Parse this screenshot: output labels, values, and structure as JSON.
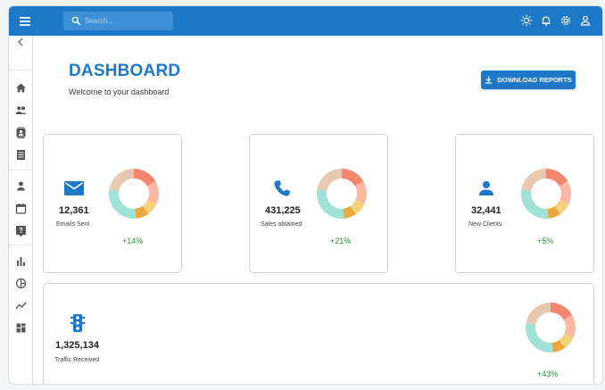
{
  "search": {
    "placeholder": "Search..."
  },
  "header": {
    "title": "DASHBOARD",
    "subtitle": "Welcome to your dashboard"
  },
  "download_button": {
    "label": "DOWNLOAD REPORTS"
  },
  "stats": [
    {
      "value": "12,361",
      "label": "Emails Sent",
      "change": "+14%",
      "icon": "email-icon"
    },
    {
      "value": "431,225",
      "label": "Sales obtained",
      "change": "+21%",
      "icon": "phone-icon"
    },
    {
      "value": "32,441",
      "label": "New Clients",
      "change": "+5%",
      "icon": "person-add-icon"
    },
    {
      "value": "1,325,134",
      "label": "Traffic Received",
      "change": "+43%",
      "icon": "traffic-icon"
    }
  ],
  "icons": {
    "topbar": [
      "menu-icon",
      "search-icon",
      "light-mode-icon",
      "notifications-icon",
      "settings-icon",
      "person-icon"
    ],
    "sidebar": [
      "chevron-left-icon",
      "home-icon",
      "people-icon",
      "contacts-icon",
      "receipt-icon",
      "person-icon",
      "calendar-icon",
      "help-icon",
      "bar-chart-icon",
      "pie-chart-icon",
      "timeline-icon",
      "map-icon"
    ]
  },
  "colors": {
    "primary": "#1e78c8",
    "positive": "#2e8b3a",
    "donut": [
      "#f4866f",
      "#fbb8a3",
      "#f6d27a",
      "#e9a93e",
      "#9fe2d6",
      "#e7c8b1"
    ]
  }
}
